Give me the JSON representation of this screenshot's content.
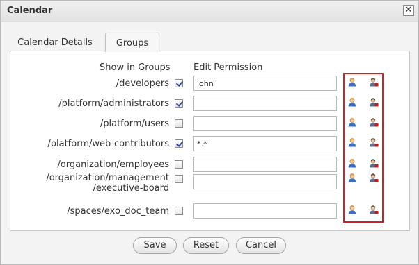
{
  "dialog": {
    "title": "Calendar",
    "close_label": "✕"
  },
  "tabs": [
    {
      "label": "Calendar Details",
      "active": false
    },
    {
      "label": "Groups",
      "active": true
    }
  ],
  "headers": {
    "show_in_groups": "Show in Groups",
    "edit_permission": "Edit Permission"
  },
  "groups": [
    {
      "name": "/developers",
      "checked": true,
      "permission": "john"
    },
    {
      "name": "/platform/administrators",
      "checked": true,
      "permission": ""
    },
    {
      "name": "/platform/users",
      "checked": false,
      "permission": ""
    },
    {
      "name": "/platform/web-contributors",
      "checked": true,
      "permission": "*.*"
    },
    {
      "name": "/organization/employees",
      "checked": false,
      "permission": ""
    },
    {
      "name": "/organization/management\n/executive-board",
      "checked": false,
      "permission": ""
    },
    {
      "name": "/spaces/exo_doc_team",
      "checked": false,
      "permission": ""
    }
  ],
  "icons": {
    "select_user": "select-user-icon",
    "select_group": "select-group-icon"
  },
  "colors": {
    "highlight": "#d21f26",
    "user_icon_hair": "#e49a1d",
    "group_icon_accent": "#c21818"
  },
  "buttons": {
    "save": "Save",
    "reset": "Reset",
    "cancel": "Cancel"
  }
}
